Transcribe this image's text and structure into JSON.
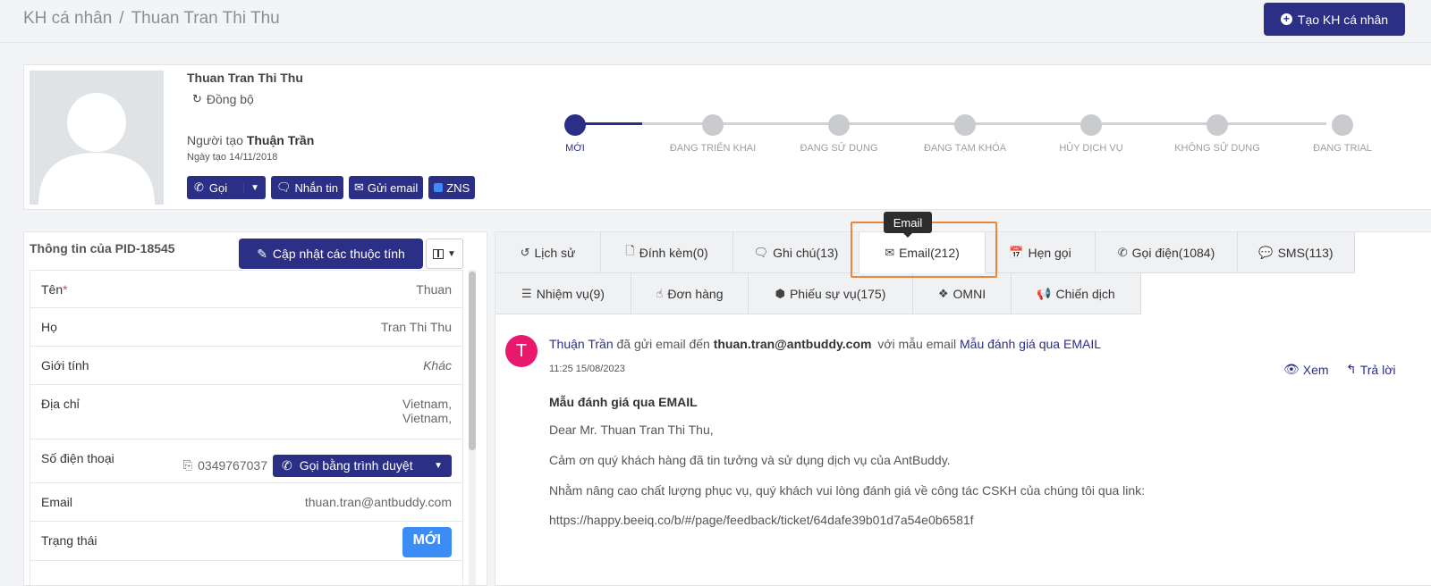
{
  "header": {
    "breadcrumb_root": "KH cá nhân",
    "breadcrumb_sep": "/",
    "breadcrumb_current": "Thuan Tran Thi Thu",
    "create_button": "Tạo KH cá nhân"
  },
  "profile": {
    "name": "Thuan Tran Thi Thu",
    "sync_label": "Đồng bộ",
    "creator_prefix": "Người tạo",
    "creator_name": "Thuận Trần",
    "created_date": "Ngày tạo 14/11/2018",
    "actions": {
      "call": "Gọi",
      "message": "Nhắn tin",
      "email": "Gửi email",
      "zns": "ZNS"
    },
    "stages": [
      "MỚI",
      "ĐANG TRIỂN KHAI",
      "ĐANG SỬ DỤNG",
      "ĐANG TẠM KHÓA",
      "HỦY DỊCH VỤ",
      "KHÔNG SỬ DỤNG",
      "ĐANG TRIAL"
    ],
    "active_stage_index": 0
  },
  "info": {
    "title": "Thông tin của PID-18545",
    "update_button": "Cập nhật các thuộc tính",
    "fields": {
      "first_name_label": "Tên",
      "first_name_required": "*",
      "first_name": "Thuan",
      "last_name_label": "Họ",
      "last_name": "Tran Thi Thu",
      "gender_label": "Giới tính",
      "gender": "Khác",
      "address_label": "Địa chỉ",
      "address_line1": "Vietnam,",
      "address_line2": "Vietnam,",
      "phone_label": "Số điện thoại",
      "phone": "0349767037",
      "call_browser_button": "Gọi bằng trình duyệt",
      "email_label": "Email",
      "email": "thuan.tran@antbuddy.com",
      "status_label": "Trạng thái",
      "status": "MỚI"
    }
  },
  "tabs": {
    "row1": {
      "history": "Lịch sử",
      "attachments": "Đính kèm(0)",
      "notes": "Ghi chú(13)",
      "email": "Email(212)",
      "appointments": "Hẹn gọi",
      "calls": "Gọi điện(1084)",
      "sms": "SMS(113)"
    },
    "row2": {
      "tasks": "Nhiệm vụ(9)",
      "orders": "Đơn hàng",
      "tickets": "Phiếu sự vụ(175)",
      "omni": "OMNI",
      "campaigns": "Chiến dịch"
    },
    "tooltip": "Email"
  },
  "email_entry": {
    "avatar_letter": "T",
    "author": "Thuận Trần",
    "action_text": "đã gửi email đến",
    "recipient": "thuan.tran@antbuddy.com",
    "template_prefix": "với mẫu email",
    "template_name": "Mẫu đánh giá qua EMAIL",
    "timestamp": "11:25 15/08/2023",
    "view_label": "Xem",
    "reply_label": "Trả lời",
    "subject": "Mẫu đánh giá qua EMAIL",
    "greeting": "Dear Mr.  Thuan Tran Thi Thu,",
    "body_line1": "Cảm ơn quý khách hàng đã tin tưởng và sử dụng dịch vụ của AntBuddy.",
    "body_line2": "Nhằm nâng cao chất lượng phục vụ, quý khách vui lòng đánh giá về công tác CSKH của chúng tôi qua link:",
    "link": "https://happy.beeiq.co/b/#/page/feedback/ticket/64dafe39b01d7a54e0b6581f"
  },
  "colors": {
    "primary": "#2b2f85",
    "badge_new": "#3b8df5",
    "avatar_email": "#e8196d",
    "highlight": "#f0843a"
  }
}
